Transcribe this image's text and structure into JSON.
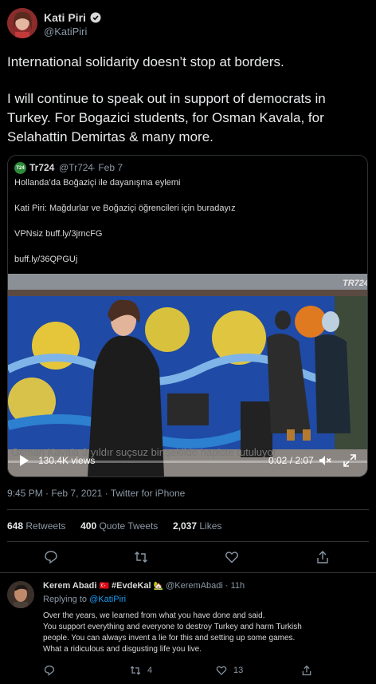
{
  "author": {
    "name": "Kati Piri",
    "handle": "@KatiPiri"
  },
  "tweet": {
    "line1": "International solidarity doesn’t stop at borders.",
    "line2": "I will continue to speak out in support of democrats in",
    "line3": "Turkey. For Bogazici students, for Osman Kavala, for",
    "line4": "Selahattin Demirtas & many more."
  },
  "quote": {
    "avatar_text": "T24",
    "name": "Tr724",
    "handle": "@Tr724",
    "date": "· Feb 7",
    "lines": [
      "Hollanda’da Boğaziçi ile dayanışma eylemi",
      "Kati Piri: Mağdurlar ve Boğaziçi öğrencileri için buradayız",
      "VPNsiz buff.ly/3jrncFG",
      "buff.ly/36QPGUj"
    ],
    "video": {
      "logo": "TR724",
      "caption": "Osman Kavala 3 yıldır suçsuz bir şekilde hapiste tutuluyor",
      "views": "130.4K views",
      "time": "0:02 / 2:07"
    }
  },
  "meta": {
    "time": "9:45 PM",
    "date": "Feb 7, 2021",
    "sep": "·",
    "source": "Twitter for iPhone"
  },
  "stats": {
    "retweets_count": "648",
    "retweets_label": "Retweets",
    "quotes_count": "400",
    "quotes_label": "Quote Tweets",
    "likes_count": "2,037",
    "likes_label": "Likes"
  },
  "reply": {
    "name": "Kerem Abadi",
    "name_flag": "🇹🇷",
    "name_tag": "#EvdeKal",
    "name_emoji": "🏡",
    "handle": "@KeremAbadi",
    "time": "· 11h",
    "replying_label": "Replying to",
    "replying_to": "@KatiPiri",
    "text_lines": [
      "Over the years, we learned from what you have done and said.",
      "You support everything and everyone to destroy Turkey and harm Turkish",
      "people. You can always invent a lie for this and setting up some games.",
      "What a ridiculous and disgusting life you live."
    ],
    "retweets": "4",
    "likes": "13"
  },
  "colors": {
    "background": "#000000",
    "text": "#d9d9d9",
    "muted": "#8b98a5",
    "link": "#1d9bf0",
    "divider": "#2f3336",
    "verified": "#d9d9d9",
    "tr724_green": "#2e8b3a",
    "turkey_red": "#e30a17"
  },
  "icons": [
    "verified-badge-icon",
    "reply-icon",
    "retweet-icon",
    "like-icon",
    "share-icon",
    "play-icon",
    "mute-icon",
    "fullscreen-icon"
  ]
}
